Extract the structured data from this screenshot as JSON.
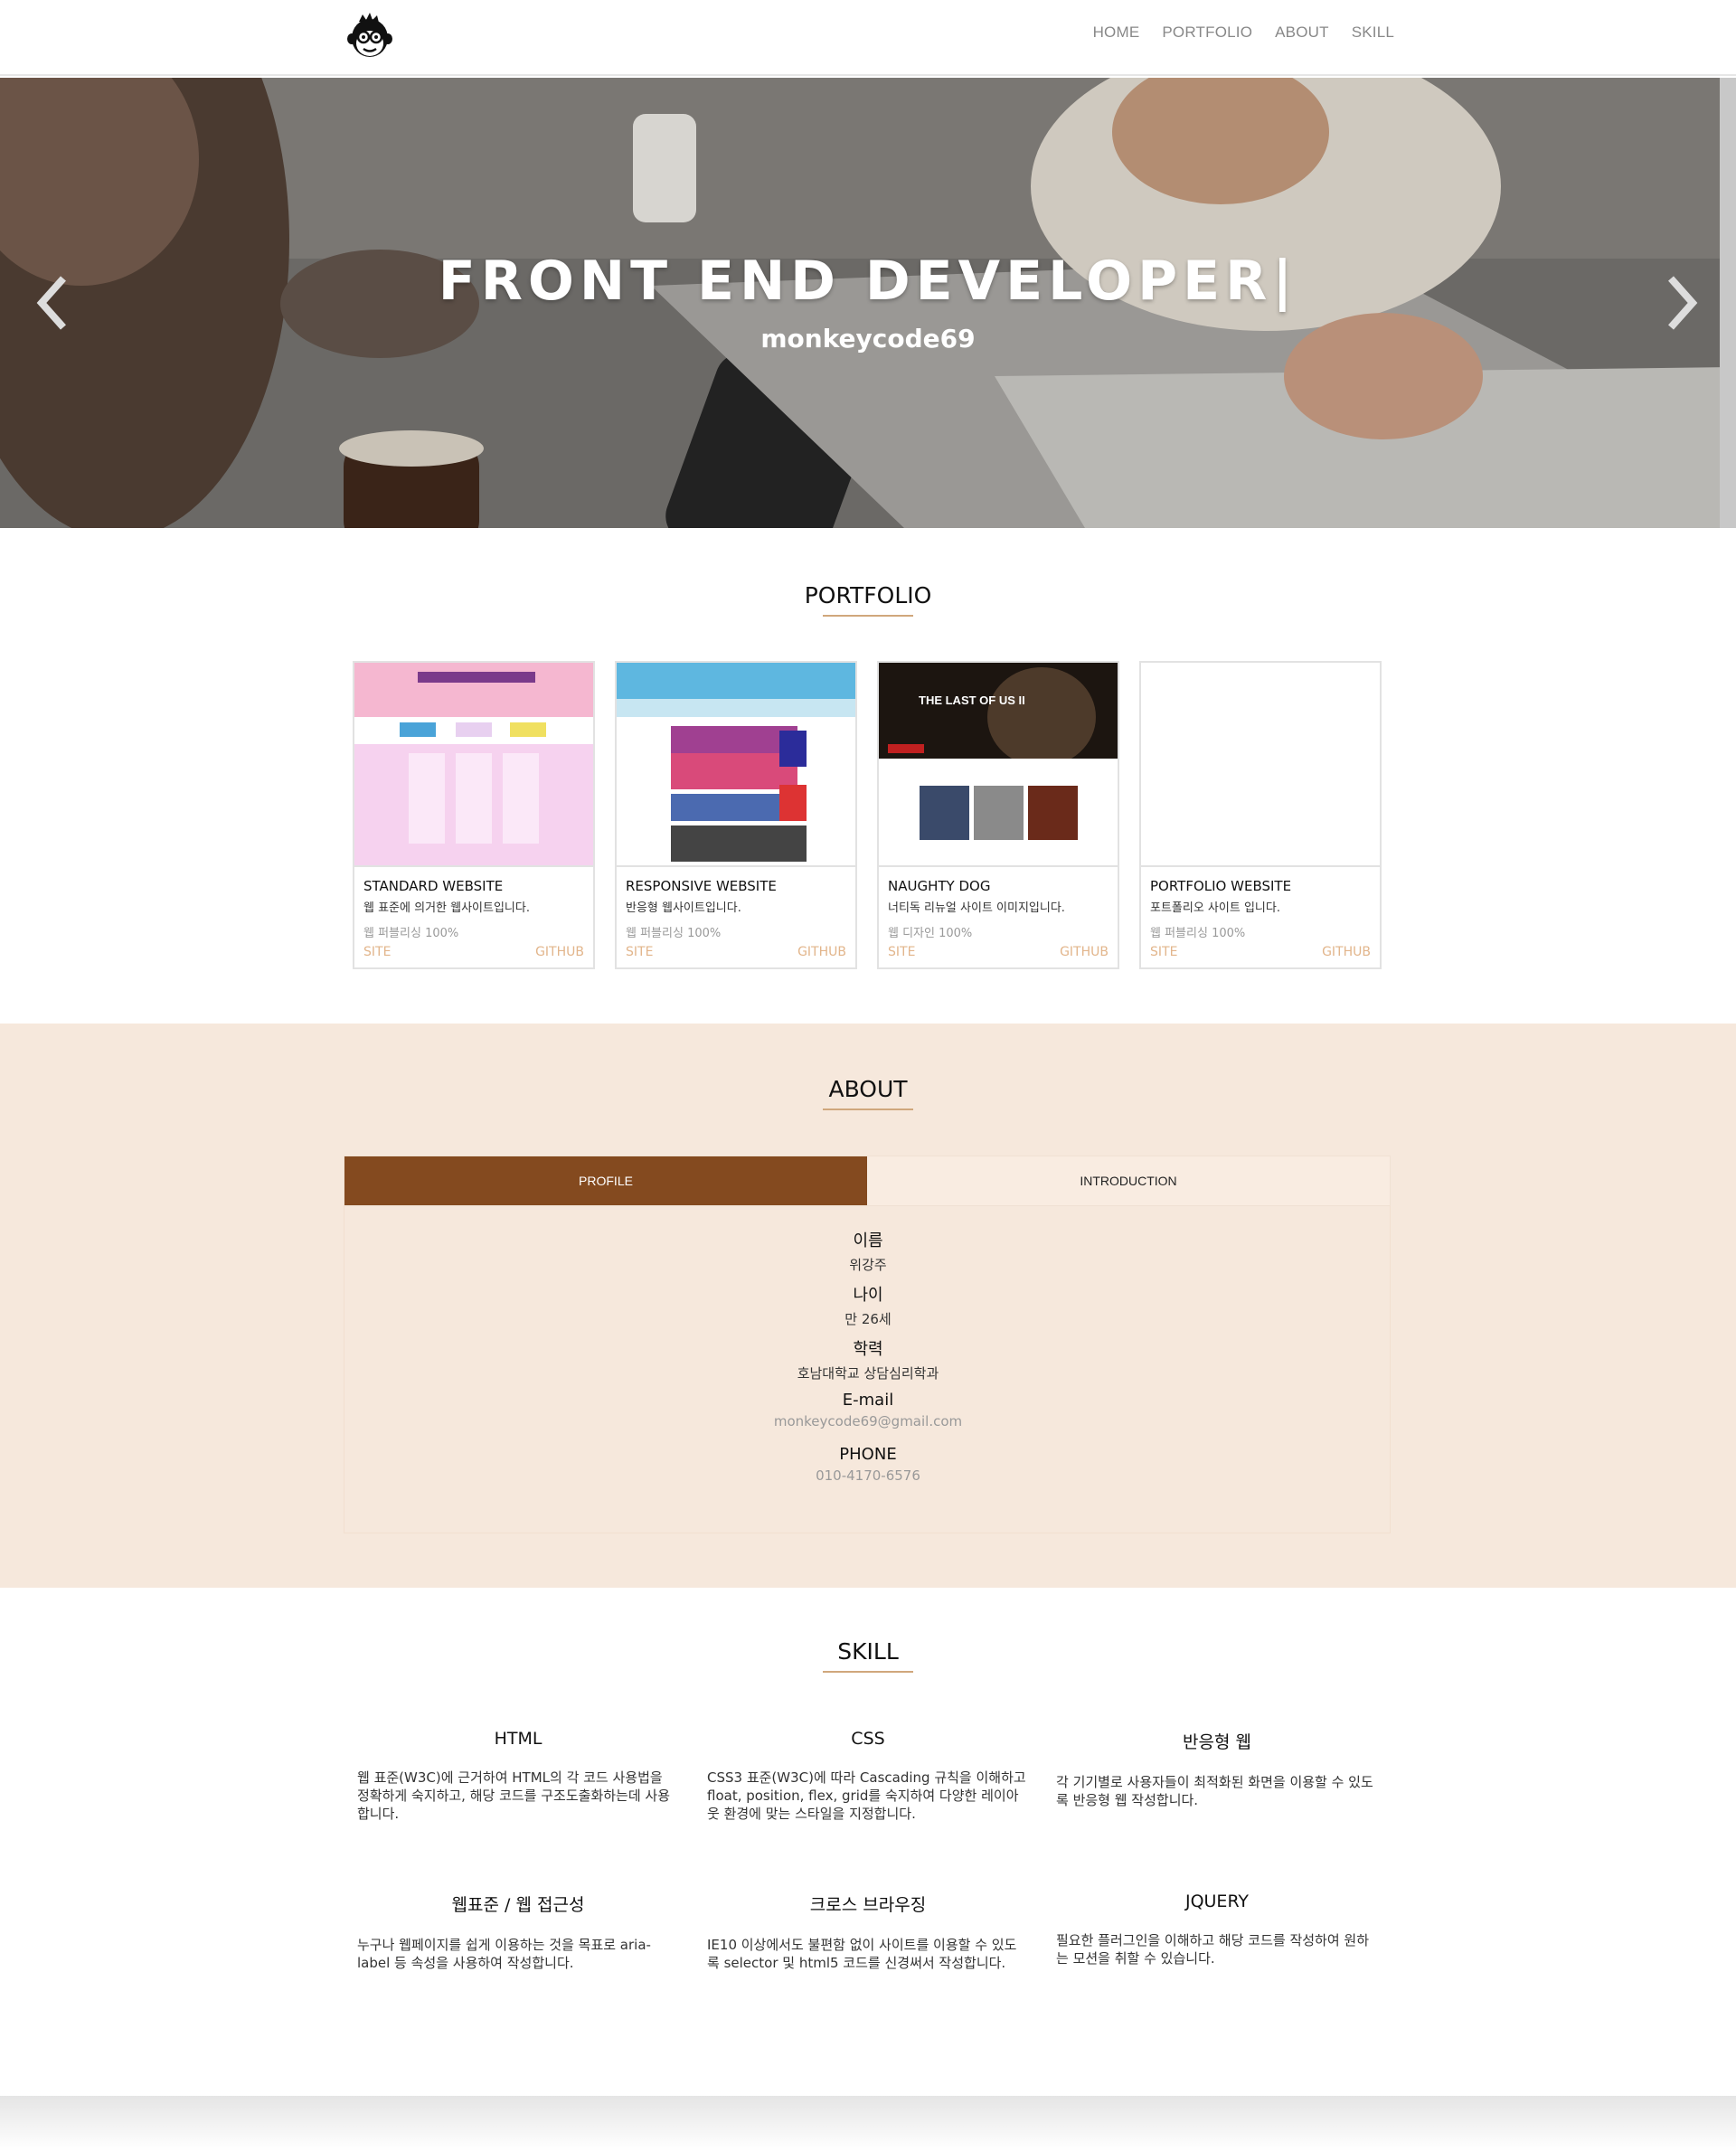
{
  "nav": {
    "items": [
      "HOME",
      "PORTFOLIO",
      "ABOUT",
      "SKILL"
    ]
  },
  "hero": {
    "title": "FRONT END DEVELOPER|",
    "subtitle": "monkeycode69"
  },
  "portfolio": {
    "heading": "PORTFOLIO",
    "cards": [
      {
        "title": "STANDARD WEBSITE",
        "desc": "웹 표준에 의거한 웹사이트입니다.",
        "rate": "웹 퍼블리싱 100%",
        "site": "SITE",
        "github": "GITHUB"
      },
      {
        "title": "RESPONSIVE WEBSITE",
        "desc": "반응형 웹사이트입니다.",
        "rate": "웹 퍼블리싱 100%",
        "site": "SITE",
        "github": "GITHUB"
      },
      {
        "title": "NAUGHTY DOG",
        "desc": "너티독 리뉴얼 사이트 이미지입니다.",
        "rate": "웹 디자인 100%",
        "site": "SITE",
        "github": "GITHUB",
        "thumb_text": "THE LAST OF US II"
      },
      {
        "title": "PORTFOLIO WEBSITE",
        "desc": "포트폴리오 사이트 입니다.",
        "rate": "웹 퍼블리싱 100%",
        "site": "SITE",
        "github": "GITHUB"
      }
    ]
  },
  "about": {
    "heading": "ABOUT",
    "tabs": [
      "PROFILE",
      "INTRODUCTION"
    ],
    "profile": [
      {
        "label": "이름",
        "value": "위강주"
      },
      {
        "label": "나이",
        "value": "만 26세"
      },
      {
        "label": "학력",
        "value": "호남대학교 상담심리학과"
      },
      {
        "label": "E-mail",
        "value": "monkeycode69@gmail.com"
      },
      {
        "label": "PHONE",
        "value": "010-4170-6576"
      }
    ]
  },
  "skill": {
    "heading": "SKILL",
    "items": [
      {
        "title": "HTML",
        "text": "웹 표준(W3C)에 근거하여 HTML의 각 코드 사용법을 정확하게 숙지하고, 해당 코드를 구조도출화하는데 사용합니다."
      },
      {
        "title": "CSS",
        "text": "CSS3 표준(W3C)에 따라 Cascading 규칙을 이해하고 float, position, flex, grid를 숙지하여 다양한 레이아웃 환경에 맞는 스타일을 지정합니다."
      },
      {
        "title": "반응형 웹",
        "text": "각 기기별로 사용자들이 최적화된 화면을 이용할 수 있도록 반응형 웹 작성합니다."
      },
      {
        "title": "웹표준 / 웹 접근성",
        "text": "누구나 웹페이지를 쉽게 이용하는 것을 목표로 aria-label 등 속성을 사용하여 작성합니다."
      },
      {
        "title": "크로스 브라우징",
        "text": "IE10 이상에서도 불편함 없이 사이트를 이용할 수 있도록 selector 및 html5 코드를 신경써서 작성합니다."
      },
      {
        "title": "JQUERY",
        "text": "필요한 플러그인을 이해하고 해당 코드를 작성하여 원하는 모션을 취할 수 있습니다."
      }
    ]
  },
  "colors": {
    "accent": "#844a1f",
    "about_bg": "#f6e8dc",
    "link": "#e2b58b"
  }
}
